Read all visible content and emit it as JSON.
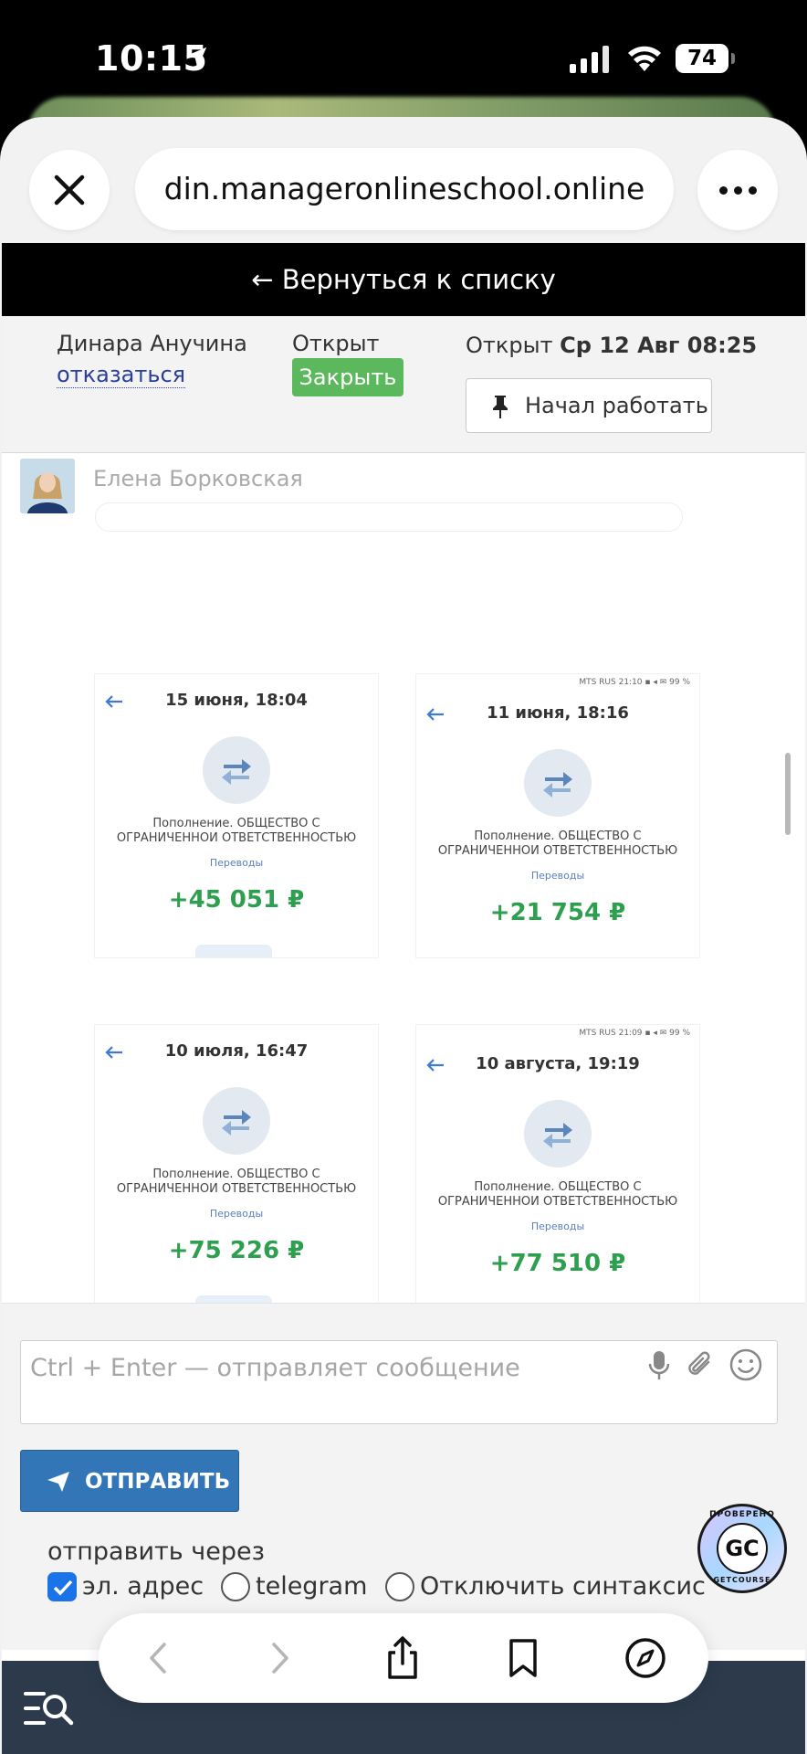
{
  "status_bar": {
    "time": "10:15",
    "battery": "74"
  },
  "browser": {
    "url": "din.manageronlineschool.online"
  },
  "page": {
    "back_link": "← Вернуться к списку",
    "assignee_name": "Динара Анучина",
    "refuse_link": "отказаться",
    "status_text": "Открыт",
    "close_button": "Закрыть",
    "opened_prefix": "Открыт",
    "opened_date": "Ср 12 Авг 08:25",
    "start_work_button": "Начал работать",
    "message_author": "Елена Борковская",
    "attachments": [
      {
        "status_line": "",
        "date": "15 июня, 18:04",
        "desc_line1": "Пополнение. ОБЩЕСТВО С",
        "desc_line2": "ОГРАНИЧЕННОЙ ОТВЕТСТВЕННОСТЬЮ",
        "category": "Переводы",
        "amount": "+45 051 ₽"
      },
      {
        "status_line": "MTS RUS 21:10 ▪ ◂ ✉ 99 %",
        "date": "11 июня, 18:16",
        "desc_line1": "Пополнение. ОБЩЕСТВО С",
        "desc_line2": "ОГРАНИЧЕННОЙ ОТВЕТСТВЕННОСТЬЮ",
        "category": "Переводы",
        "amount": "+21 754 ₽"
      },
      {
        "status_line": "",
        "date": "10 июля, 16:47",
        "desc_line1": "Пополнение. ОБЩЕСТВО С",
        "desc_line2": "ОГРАНИЧЕННОЙ ОТВЕТСТВЕННОСТЬЮ",
        "category": "Переводы",
        "amount": "+75 226 ₽"
      },
      {
        "status_line": "MTS RUS 21:09 ▪ ◂ ✉ 99 %",
        "date": "10 августа, 19:19",
        "desc_line1": "Пополнение. ОБЩЕСТВО С",
        "desc_line2": "ОГРАНИЧЕННОЙ ОТВЕТСТВЕННОСТЬЮ",
        "category": "Переводы",
        "amount": "+77 510 ₽"
      }
    ],
    "composer": {
      "placeholder": "Ctrl + Enter — отправляет сообщение",
      "send_button": "ОТПРАВИТЬ",
      "send_via_label": "отправить через",
      "options": [
        {
          "label": "эл. адрес",
          "checked": true
        },
        {
          "label": "telegram",
          "checked": false
        },
        {
          "label": "Отключить синтаксис",
          "checked": false
        }
      ]
    },
    "badge": {
      "top_text": "ПРОВЕРЕНО",
      "center": "GC",
      "bottom_text": "GETCOURSE"
    }
  },
  "colors": {
    "accent_blue": "#3276b8",
    "close_green": "#5cb85c",
    "amount_green": "#2e9e4f",
    "footer_dark": "#2c3a4b"
  },
  "icons": [
    "location-arrow-icon",
    "signal-icon",
    "wifi-icon",
    "close-icon",
    "more-icon",
    "pin-icon",
    "mic-icon",
    "paperclip-icon",
    "smile-icon",
    "send-plane-icon",
    "search-list-icon",
    "back-icon",
    "forward-icon",
    "share-icon",
    "bookmarks-icon",
    "compass-icon"
  ]
}
